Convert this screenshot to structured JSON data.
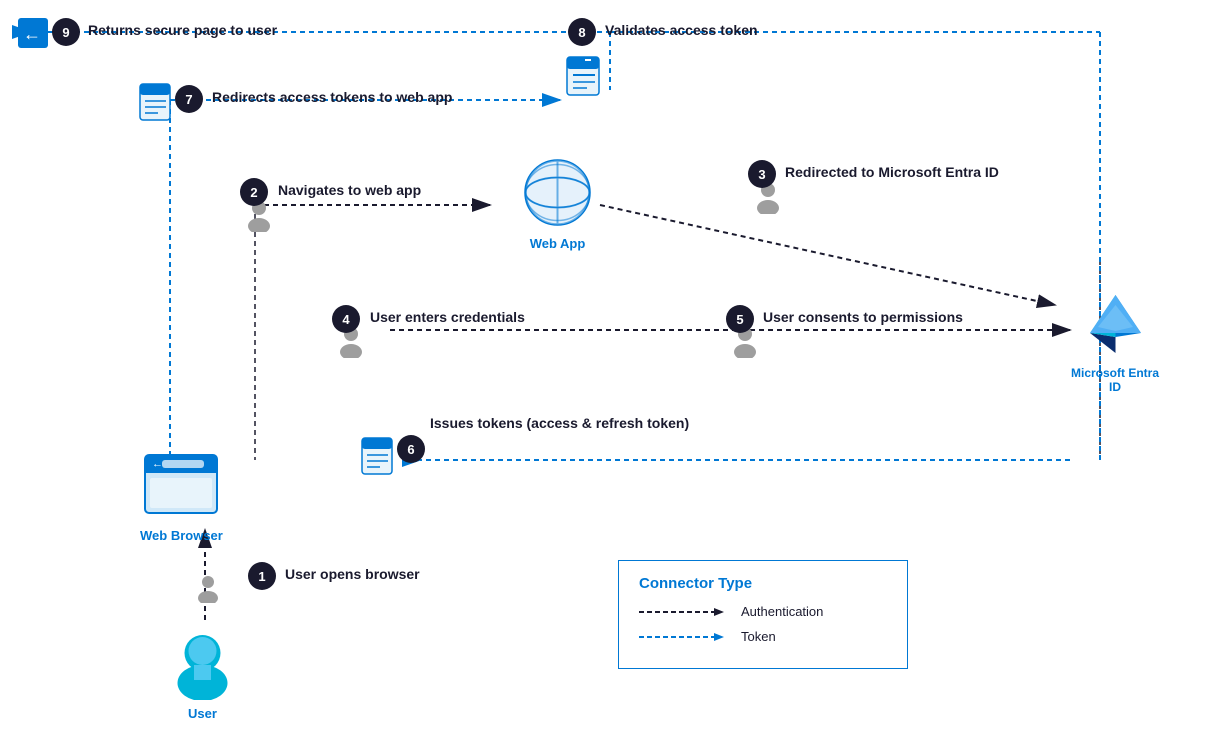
{
  "steps": [
    {
      "num": "1",
      "label": "User opens browser"
    },
    {
      "num": "2",
      "label": "Navigates to web app"
    },
    {
      "num": "3",
      "label": "Redirected to Microsoft Entra ID"
    },
    {
      "num": "4",
      "label": "User enters credentials"
    },
    {
      "num": "5",
      "label": "User consents to permissions"
    },
    {
      "num": "6",
      "label": "Issues tokens (access & refresh token)"
    },
    {
      "num": "7",
      "label": "Redirects access tokens to web app"
    },
    {
      "num": "8",
      "label": "Validates access token"
    },
    {
      "num": "9",
      "label": "Returns secure page to user"
    }
  ],
  "icons": {
    "webBrowser": "Web Browser",
    "webApp": "Web App",
    "entraID": "Microsoft Entra ID",
    "user": "User"
  },
  "legend": {
    "title": "Connector Type",
    "auth": "Authentication",
    "token": "Token"
  }
}
